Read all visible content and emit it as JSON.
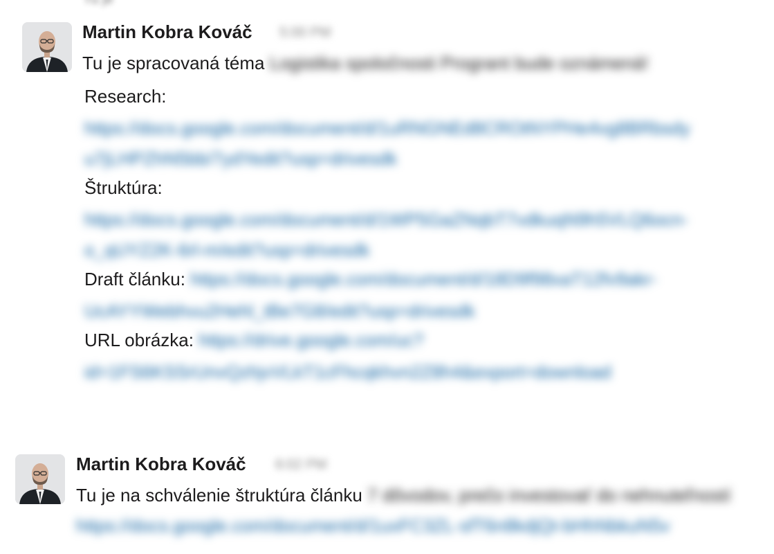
{
  "messages": [
    {
      "sender": "Martin Kobra Kováč",
      "timestamp": "5:00 PM",
      "intro_visible": "Tu je spracovaná téma",
      "intro_blurred": "Logistika spoločnosti Progrant bude oznámená!",
      "research_label": "Research:",
      "research_url_1": "https://docs.google.com/document/d/1uRNGNEd8CROtNYPHe4vg8BRbsdy",
      "research_url_2": "u7jLHPZhN5bb/7ydYedit?usp=drivesdk",
      "struktura_label": "Štruktúra:",
      "struktura_url_1": "https://docs.google.com/document/d/1WP5GaZNqbT7vdkuqN9h5VLQ6ocn-",
      "struktura_url_2": "o_qUYZ2K-6rl-m/edit?usp=drivesdk",
      "draft_label": "Draft článku:",
      "draft_url_1": "https://docs.google.com/document/d/18D9f98xaT12fv9akr-",
      "draft_url_2": "UcAYYWebhvu2Hehl_tBe7G8/edit?usp=drivesdk",
      "url_obrazka_label": "URL obrázka:",
      "url_obrazka_1": "https://drive.google.com/uc?",
      "url_obrazka_2": "id=1FS6KSSrUnvQzhjvVLkT1cFhcqkhvn2Z8h4&export=download"
    },
    {
      "sender": "Martin Kobra Kováč",
      "timestamp": "6:02 PM",
      "intro_visible": "Tu je na schválenie štruktúra článku",
      "intro_blurred": "7 dôvodov, prečo investovať do nehnuteľností",
      "url_1": "https://docs.google.com/document/d/1uxFC3ZL-sfT6n8kdjQt-bHhNbkuN5v"
    }
  ],
  "icons": {
    "avatar": "person-portrait-icon"
  },
  "colors": {
    "link": "#1264a3",
    "text": "#1d1c1d",
    "timestamp": "#868686"
  }
}
